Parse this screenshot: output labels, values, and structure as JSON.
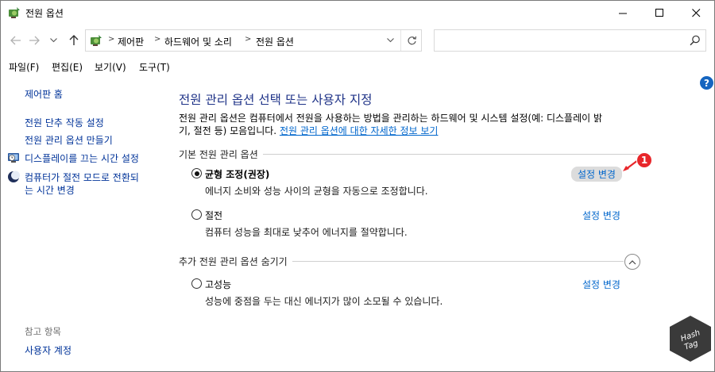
{
  "window": {
    "title": "전원 옵션",
    "icon": "power-options-icon"
  },
  "address_bar": {
    "breadcrumbs": [
      "제어판",
      "하드웨어 및 소리",
      "전원 옵션"
    ],
    "search_placeholder": ""
  },
  "menu": [
    {
      "label": "파일(F)"
    },
    {
      "label": "편집(E)"
    },
    {
      "label": "보기(V)"
    },
    {
      "label": "도구(T)"
    }
  ],
  "sidebar": {
    "home_link": "제어판 홈",
    "links": [
      {
        "label": "전원 단추 작동 설정"
      },
      {
        "label": "전원 관리 옵션 만들기"
      },
      {
        "label": "디스플레이를 끄는 시간 설정",
        "icon": "display-schedule-icon"
      },
      {
        "label_line1": "컴퓨터가 절전 모드로 전환되",
        "label_line2": "는 시간 변경",
        "icon": "moon-sleep-icon"
      }
    ],
    "see_also_heading": "참고 항목",
    "see_also_links": [
      {
        "label": "사용자 계정"
      }
    ]
  },
  "main": {
    "title": "전원 관리 옵션 선택 또는 사용자 지정",
    "description_line1": "전원 관리 옵션은 컴퓨터에서 전원을 사용하는 방법을 관리하는 하드웨어 및 시스템 설정(예: 디스플레이 밝",
    "description_line2": "기, 절전 등) 모음입니다. ",
    "description_link": "전원 관리 옵션에 대한 자세한 정보 보기",
    "help_label": "?",
    "section_basic": "기본 전원 관리 옵션",
    "section_more": "추가 전원 관리 옵션 숨기기",
    "plans": [
      {
        "name": "균형 조정(권장)",
        "description": "에너지 소비와 성능 사이의 균형을 자동으로 조정합니다.",
        "link": "설정 변경",
        "selected": true
      },
      {
        "name": "절전",
        "description": "컴퓨터 성능을 최대로 낮추어 에너지를 절약합니다.",
        "link": "설정 변경",
        "selected": false
      },
      {
        "name": "고성능",
        "description": "성능에 중점을 두는 대신 에너지가 많이 소모될 수 있습니다.",
        "link": "설정 변경",
        "selected": false
      }
    ]
  },
  "annotation": {
    "badge": "1",
    "color": "#e8262a"
  },
  "watermark": {
    "text_line1": "Hash",
    "text_line2": "Tag"
  },
  "colors": {
    "title_blue": "#1e3287",
    "link_blue": "#0066cc",
    "sidebar_link": "#003399"
  }
}
